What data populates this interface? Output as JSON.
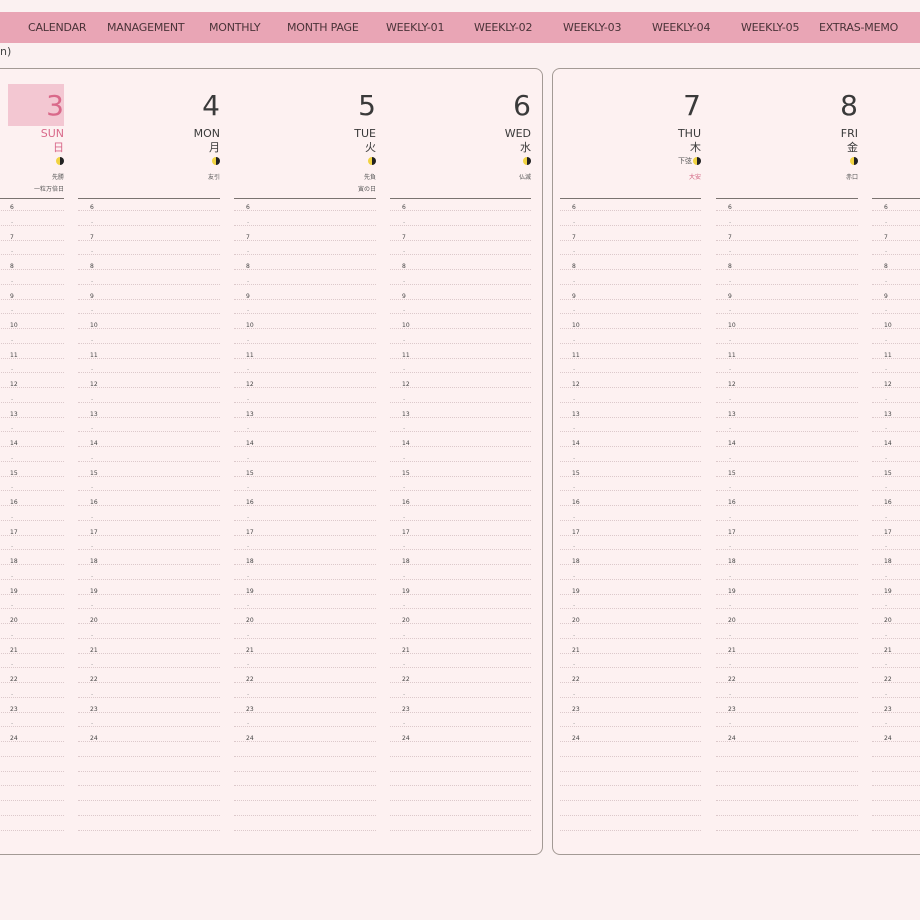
{
  "nav": {
    "tabs": [
      {
        "label": "CALENDAR"
      },
      {
        "label": "MANAGEMENT"
      },
      {
        "label": "MONTHLY"
      },
      {
        "label": "MONTH PAGE"
      },
      {
        "label": "WEEKLY-01"
      },
      {
        "label": "WEEKLY-02"
      },
      {
        "label": "WEEKLY-03"
      },
      {
        "label": "WEEKLY-04"
      },
      {
        "label": "WEEKLY-05"
      },
      {
        "label": "EXTRAS-MEMO"
      }
    ]
  },
  "corner_mark": "n)",
  "days": [
    {
      "num": "3",
      "wd": "SUN",
      "kanji": "日",
      "moon_text": "",
      "note1": "先勝",
      "note2": "一粒万倍日"
    },
    {
      "num": "4",
      "wd": "MON",
      "kanji": "月",
      "moon_text": "",
      "note1": "友引",
      "note2": ""
    },
    {
      "num": "5",
      "wd": "TUE",
      "kanji": "火",
      "moon_text": "",
      "note1": "先負",
      "note2": "寅の日"
    },
    {
      "num": "6",
      "wd": "WED",
      "kanji": "水",
      "moon_text": "",
      "note1": "仏滅",
      "note2": ""
    },
    {
      "num": "7",
      "wd": "THU",
      "kanji": "木",
      "moon_text": "下弦",
      "note1": "大安",
      "note2": ""
    },
    {
      "num": "8",
      "wd": "FRI",
      "kanji": "金",
      "moon_text": "",
      "note1": "赤口",
      "note2": ""
    }
  ],
  "hour_labels": [
    "6",
    "7",
    "8",
    "9",
    "10",
    "11",
    "12",
    "13",
    "14",
    "15",
    "16",
    "17",
    "18",
    "19",
    "20",
    "21",
    "22",
    "23",
    "24"
  ],
  "half_mark": "-",
  "colors": {
    "nav_bg": "#e9a5b5",
    "page_bg": "#fbf1f1",
    "sunday": "#d9698a",
    "highlight": "#f3c7d2"
  },
  "icons": {
    "moon": "half-moon-icon"
  }
}
